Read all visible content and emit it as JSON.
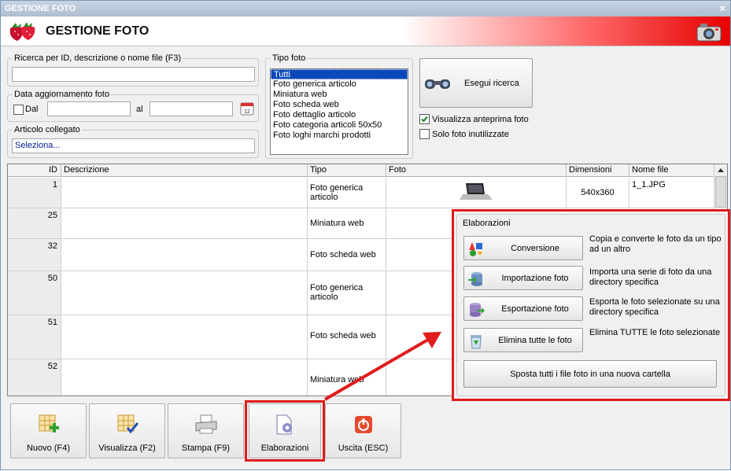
{
  "window": {
    "title": "GESTIONE FOTO",
    "close": "×"
  },
  "header": {
    "title": "GESTIONE FOTO"
  },
  "search": {
    "group_title": "Ricerca per ID, descrizione o nome file (F3)",
    "value": ""
  },
  "date": {
    "group_title": "Data aggiornamento foto",
    "dal_label": "Dal",
    "al_label": "al",
    "from_value": "",
    "to_value": ""
  },
  "article": {
    "group_title": "Articolo collegato",
    "value": "Seleziona..."
  },
  "tipo_foto": {
    "group_title": "Tipo foto",
    "items": [
      "Tutti",
      "Foto generica articolo",
      "Miniatura web",
      "Foto scheda web",
      "Foto dettaglio articolo",
      "Foto categoria articoli 50x50",
      "Foto loghi marchi prodotti"
    ],
    "selected": "Tutti"
  },
  "search_button": {
    "label": "Esegui ricerca"
  },
  "options": {
    "preview_label": "Visualizza anteprima foto",
    "preview_checked": true,
    "unused_label": "Solo foto inutilizzate",
    "unused_checked": false
  },
  "grid": {
    "columns": [
      "ID",
      "Descrizione",
      "Tipo",
      "Foto",
      "Dimensioni",
      "Nome file"
    ],
    "rows": [
      {
        "id": "1",
        "descrizione": "",
        "tipo": "Foto generica articolo",
        "dimensioni": "540x360",
        "nome_file": "1_1.JPG"
      },
      {
        "id": "25",
        "descrizione": "",
        "tipo": "Miniatura web",
        "dimensioni": "",
        "nome_file": ""
      },
      {
        "id": "32",
        "descrizione": "",
        "tipo": "Foto scheda web",
        "dimensioni": "",
        "nome_file": ""
      },
      {
        "id": "50",
        "descrizione": "",
        "tipo": "Foto generica articolo",
        "dimensioni": "",
        "nome_file": ""
      },
      {
        "id": "51",
        "descrizione": "",
        "tipo": "Foto scheda web",
        "dimensioni": "",
        "nome_file": ""
      },
      {
        "id": "52",
        "descrizione": "",
        "tipo": "Miniatura web",
        "dimensioni": "",
        "nome_file": ""
      }
    ]
  },
  "elaborazioni": {
    "group_title": "Elaborazioni",
    "buttons": [
      {
        "label": "Conversione",
        "desc": "Copia e converte le foto da un tipo ad un altro"
      },
      {
        "label": "Importazione foto",
        "desc": "Importa una serie di foto da una directory specifica"
      },
      {
        "label": "Esportazione foto",
        "desc": "Esporta le foto selezionate su una directory specifica"
      },
      {
        "label": "Elimina tutte le foto",
        "desc": "Elimina TUTTE le foto selezionate"
      }
    ],
    "move_label": "Sposta tutti i file foto in una nuova cartella"
  },
  "toolbar": {
    "nuovo": "Nuovo (F4)",
    "visualizza": "Visualizza (F2)",
    "stampa": "Stampa (F9)",
    "elaborazioni": "Elaborazioni",
    "uscita": "Uscita (ESC)"
  },
  "colors": {
    "highlight": "#e01b1b",
    "selection": "#0a49b9",
    "header_gradient_end": "#e80000"
  }
}
